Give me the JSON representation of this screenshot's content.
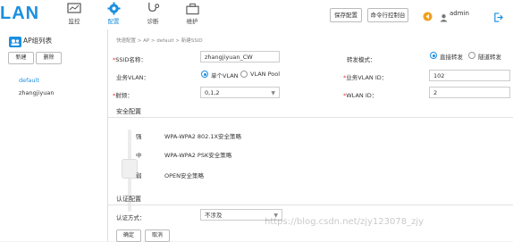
{
  "app": {
    "logo": "LAN"
  },
  "nav": [
    {
      "label": "监控",
      "icon": "monitor-icon"
    },
    {
      "label": "配置",
      "icon": "gear-icon"
    },
    {
      "label": "诊断",
      "icon": "stethoscope-icon"
    },
    {
      "label": "维护",
      "icon": "toolbox-icon"
    }
  ],
  "toolbar": {
    "save_label": "保存配置",
    "console_label": "命令行控制台",
    "user": "admin"
  },
  "sidebar": {
    "title": "AP组列表",
    "new_label": "新建",
    "delete_label": "删除",
    "items": [
      "default",
      "zhangjiyuan"
    ]
  },
  "breadcrumb": "快速配置 > AP > default > 新建SSID",
  "form": {
    "ssid_label": "SSID名称：",
    "ssid_value": "zhangjiyuan_CW",
    "forward_label": "转发模式：",
    "forward_opt1": "直接转发",
    "forward_opt2": "隧道转发",
    "vlan_label": "业务VLAN：",
    "vlan_opt1": "单个VLAN",
    "vlan_opt2": "VLAN Pool",
    "vlanid_label": "业务VLAN ID：",
    "vlanid_value": "102",
    "radio_label": "射频：",
    "radio_value": "0,1,2",
    "wlanid_label": "WLAN ID：",
    "wlanid_value": "2"
  },
  "security": {
    "title": "安全配置",
    "levels": [
      "强",
      "中",
      "弱"
    ],
    "policies": [
      "WPA-WPA2 802.1X安全策略",
      "WPA-WPA2 PSK安全策略",
      "OPEN安全策略"
    ]
  },
  "auth": {
    "title": "认证配置",
    "method_label": "认证方式：",
    "method_value": "不涉及",
    "ok_label": "确定",
    "cancel_label": "取消"
  },
  "watermark": "https://blog.csdn.net/zjy123078_zjy",
  "colors": {
    "accent": "#1b8fe0",
    "required": "#e33333"
  }
}
